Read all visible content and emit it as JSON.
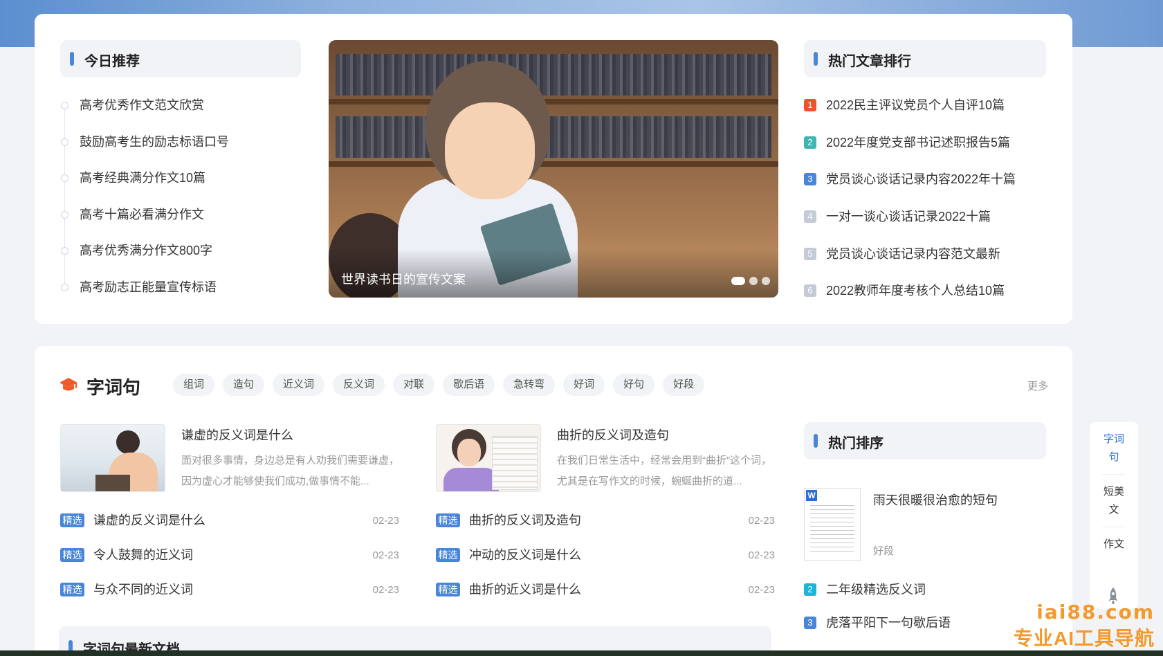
{
  "today_recommend": {
    "title": "今日推荐",
    "items": [
      "高考优秀作文范文欣赏",
      "鼓励高考生的励志标语口号",
      "高考经典满分作文10篇",
      "高考十篇必看满分作文",
      "高考优秀满分作文800字",
      "高考励志正能量宣传标语"
    ]
  },
  "banner": {
    "caption": "世界读书日的宣传文案",
    "slide_count": 3,
    "active_slide": 1
  },
  "hot_articles": {
    "title": "热门文章排行",
    "items": [
      {
        "rank": "1",
        "text": "2022民主评议党员个人自评10篇",
        "color": "#f0522c"
      },
      {
        "rank": "2",
        "text": "2022年度党支部书记述职报告5篇",
        "color": "#3fb6b0"
      },
      {
        "rank": "3",
        "text": "党员谈心谈话记录内容2022年十篇",
        "color": "#4a86d8"
      },
      {
        "rank": "4",
        "text": "一对一谈心谈话记录2022十篇",
        "color": "#c4cbd6"
      },
      {
        "rank": "5",
        "text": "党员谈心谈话记录内容范文最新",
        "color": "#c4cbd6"
      },
      {
        "rank": "6",
        "text": "2022教师年度考核个人总结10篇",
        "color": "#c4cbd6"
      }
    ]
  },
  "words": {
    "title": "字词句",
    "icon": "graduation-cap-icon",
    "tags": [
      "组词",
      "造句",
      "近义词",
      "反义词",
      "对联",
      "歇后语",
      "急转弯",
      "好词",
      "好句",
      "好段"
    ],
    "more": "更多",
    "features": [
      {
        "title": "谦虚的反义词是什么",
        "desc": "面对很多事情，身边总是有人劝我们需要谦虚，因为虚心才能够使我们成功,做事情不能..."
      },
      {
        "title": "曲折的反义词及造句",
        "desc": "在我们日常生活中，经常会用到“曲折”这个词，尤其是在写作文的时候，蜿蜒曲折的道..."
      }
    ],
    "left_list": [
      {
        "badge": "精选",
        "text": "谦虚的反义词是什么",
        "date": "02-23"
      },
      {
        "badge": "精选",
        "text": "令人鼓舞的近义词",
        "date": "02-23"
      },
      {
        "badge": "精选",
        "text": "与众不同的近义词",
        "date": "02-23"
      }
    ],
    "right_list": [
      {
        "badge": "精选",
        "text": "曲折的反义词及造句",
        "date": "02-23"
      },
      {
        "badge": "精选",
        "text": "冲动的反义词是什么",
        "date": "02-23"
      },
      {
        "badge": "精选",
        "text": "曲折的近义词是什么",
        "date": "02-23"
      }
    ],
    "latest_title": "字词句最新文档"
  },
  "side_hot": {
    "title": "热门排序",
    "first": {
      "title": "雨天很暖很治愈的短句",
      "tag": "好段",
      "doc_mark": "W"
    },
    "items": [
      {
        "rank": "2",
        "text": "二年级精选反义词",
        "color": "#19b6d6"
      },
      {
        "rank": "3",
        "text": "虎落平阳下一句歇后语",
        "color": "#4a86d8"
      }
    ]
  },
  "float_nav": {
    "items": [
      "字词句",
      "短美文",
      "作文"
    ],
    "active": 0,
    "icon": "rocket-icon"
  },
  "watermark": {
    "url": "iai88.com",
    "text": "专业AI工具导航"
  }
}
